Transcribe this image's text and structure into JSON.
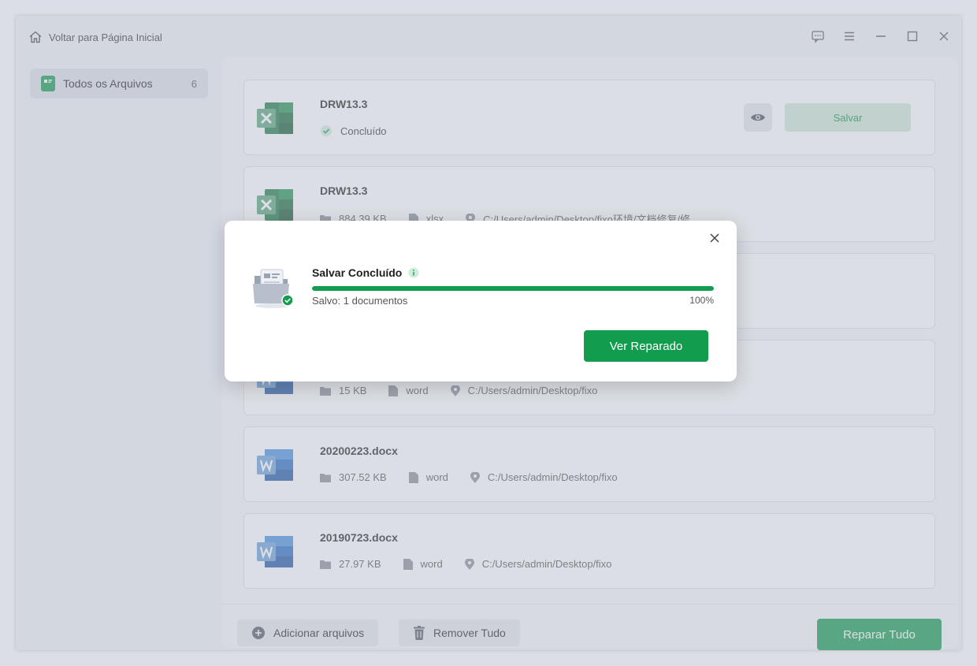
{
  "titlebar": {
    "home_label": "Voltar para Página Inicial"
  },
  "sidebar": {
    "items": [
      {
        "label": "Todos os Arquivos",
        "count": "6"
      }
    ]
  },
  "files": [
    {
      "name": "DRW13.3",
      "type_icon": "excel-icon",
      "status": "Concluído",
      "save_label": "Salvar"
    },
    {
      "name": "DRW13.3",
      "type_icon": "excel-icon",
      "size": "884.39 KB",
      "ext": "xlsx",
      "path": "C:/Users/admin/Desktop/fixo环境/文档修复/修"
    },
    {
      "name": "",
      "type_icon": "word-icon"
    },
    {
      "name": "",
      "type_icon": "word-icon",
      "size": "15 KB",
      "ext": "word",
      "path": "C:/Users/admin/Desktop/fixo"
    },
    {
      "name": "20200223.docx",
      "type_icon": "word-icon",
      "size": "307.52 KB",
      "ext": "word",
      "path": "C:/Users/admin/Desktop/fixo"
    },
    {
      "name": "20190723.docx",
      "type_icon": "word-icon",
      "size": "27.97 KB",
      "ext": "word",
      "path": "C:/Users/admin/Desktop/fixo"
    }
  ],
  "bottombar": {
    "add_label": "Adicionar arquivos",
    "remove_label": "Remover Tudo",
    "repair_label": "Reparar Tudo"
  },
  "modal": {
    "title": "Salvar Concluído",
    "saved_text": "Salvo: 1 documentos",
    "percent": "100%",
    "progress_percent": 100,
    "view_label": "Ver Reparado"
  },
  "colors": {
    "accent": "#129c4d",
    "excel": "#1e7a45",
    "word": "#2b6cc4"
  }
}
